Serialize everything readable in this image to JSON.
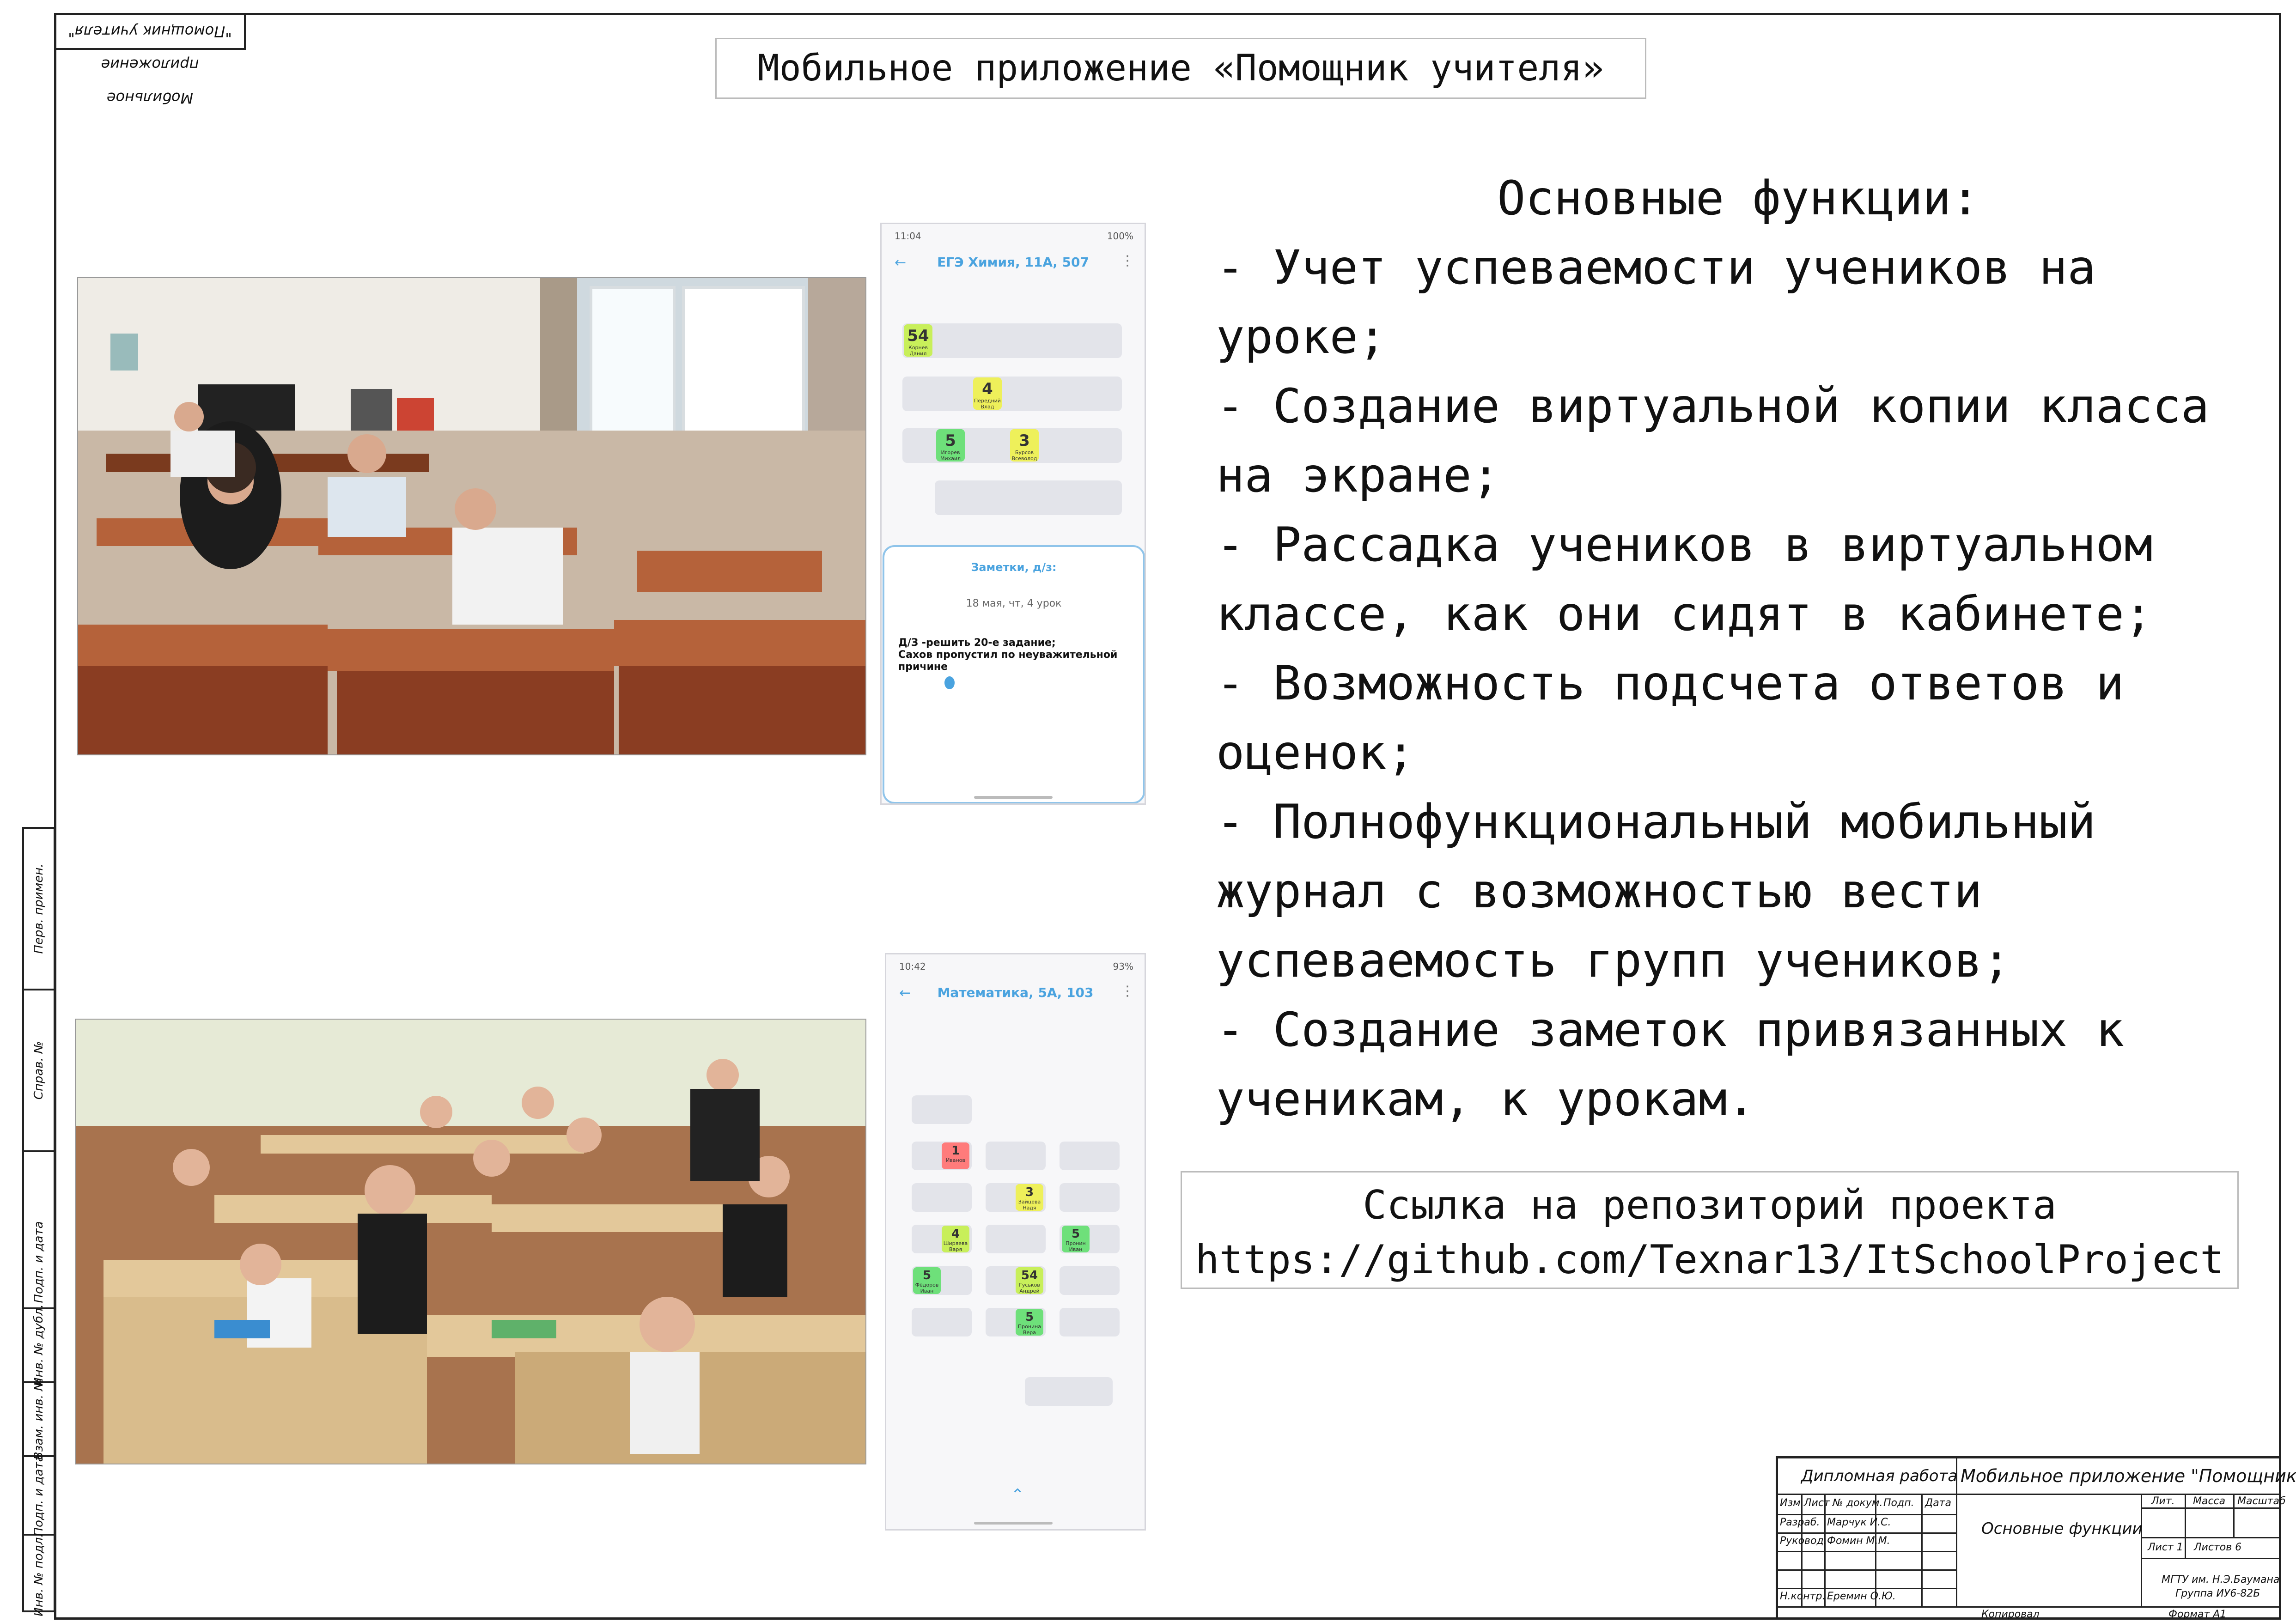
{
  "stamp_top": "Мобильное приложение \"Помощник учителя\"",
  "title": "Мобильное приложение «Помощник учителя»",
  "phone1": {
    "status_time": "11:04",
    "status_right": "100%",
    "title": "ЕГЭ Химия, 11А, 507",
    "cells": [
      {
        "grade": "54",
        "name": "Корнев Данил",
        "color": "#c8ef5a"
      },
      {
        "grade": "4",
        "name": "Передний Влад",
        "color": "#eef05a"
      },
      {
        "grade": "5",
        "name": "Игорев Михаил",
        "color": "#6ee07a"
      },
      {
        "grade": "3",
        "name": "Бурсов Всеволод",
        "color": "#eef05a"
      }
    ],
    "notes_title": "Заметки, д/з:",
    "notes_date": "18 мая, чт, 4 урок",
    "notes_text": "Д/З -решить 20-е задание;\nСахов пропустил по неуважительной причине"
  },
  "phone2": {
    "status_time": "10:42",
    "status_right": "93%",
    "title": "Математика, 5А, 103",
    "cells": [
      {
        "grade": "1",
        "name": "Иванов",
        "color": "#ff7b7b"
      },
      {
        "grade": "3",
        "name": "Зайцева Надя",
        "color": "#eef05a"
      },
      {
        "grade": "5",
        "name": "Пронин Иван",
        "color": "#6ee07a"
      },
      {
        "grade": "4",
        "name": "Ширяева Варя",
        "color": "#c8ef5a"
      },
      {
        "grade": "5",
        "name": "Фёдоров Иван",
        "color": "#6ee07a"
      },
      {
        "grade": "54",
        "name": "Гуськов Андрей",
        "color": "#c8ef5a"
      },
      {
        "grade": "5",
        "name": "Пронина Вера",
        "color": "#6ee07a"
      }
    ]
  },
  "features": {
    "heading": "Основные функции:",
    "lines": [
      "- Учет успеваемости учеников на",
      "уроке;",
      "- Создание виртуальной копии класса",
      "на экране;",
      "- Рассадка учеников в виртуальном",
      "классе, как они сидят в кабинете;",
      "- Возможность подсчета ответов и",
      "оценок;",
      "- Полнофункциональный мобильный",
      "журнал с возможностью вести",
      "успеваемость групп учеников;",
      "- Создание заметок привязанных к",
      "ученикам, к урокам."
    ]
  },
  "repo": {
    "label": "Ссылка на репозиторий проекта",
    "url": "https://github.com/Texnar13/ItSchoolProject"
  },
  "side_labels": [
    "Перв. примен.",
    "Справ. №",
    "Подп. и дата",
    "Инв. № дубл.",
    "Взам. инв. №",
    "Подп. и дата",
    "Инв. № подл."
  ],
  "title_block": {
    "work_type": "Дипломная работа",
    "project": "Мобильное приложение \"Помощник учителя\"",
    "sheet_title": "Основные функции",
    "col_izm": "Изм",
    "col_list": "Лист",
    "col_doc": "№ докум.",
    "col_sign": "Подп.",
    "col_date": "Дата",
    "razrab_label": "Разраб.",
    "razrab_name": "Марчук И.С.",
    "ruk_label": "Руковод.",
    "ruk_name": "Фомин М.М.",
    "nkontr_label": "Н.контр.",
    "nkontr_name": "Еремин О.Ю.",
    "lit": "Лит.",
    "massa": "Масса",
    "masshtab": "Масштаб",
    "list": "Лист 1",
    "listov": "Листов 6",
    "org": "МГТУ им. Н.Э.Баумана",
    "group": "Группа ИУ6-82Б",
    "kopiroval": "Копировал",
    "format": "Формат А1"
  }
}
